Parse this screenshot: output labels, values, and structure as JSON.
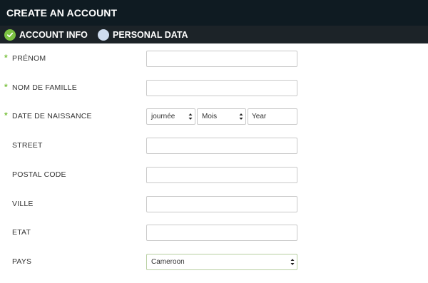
{
  "header": {
    "title": "CREATE AN ACCOUNT"
  },
  "steps": [
    {
      "label": "ACCOUNT INFO",
      "status": "complete",
      "icon": "check-circle-icon"
    },
    {
      "label": "PERSONAL DATA",
      "status": "pending",
      "icon": "circle-icon"
    }
  ],
  "form": {
    "required_marker": "*",
    "first_name": {
      "label": "PRÉNOM",
      "value": ""
    },
    "last_name": {
      "label": "NOM DE FAMILLE",
      "value": ""
    },
    "birth_date": {
      "label": "DATE DE NAISSANCE",
      "day_selected": "journée",
      "month_selected": "Mois",
      "year_placeholder": "Year"
    },
    "street": {
      "label": "STREET",
      "value": ""
    },
    "postal_code": {
      "label": "POSTAL CODE",
      "value": ""
    },
    "city": {
      "label": "VILLE",
      "value": ""
    },
    "state": {
      "label": "ETAT",
      "value": ""
    },
    "country": {
      "label": "PAYS",
      "selected": "Cameroon"
    }
  },
  "colors": {
    "title_bar": "#0f1b22",
    "steps_bar": "#1c2328",
    "accent_green": "#7cc242",
    "pending_step": "#cfdcef"
  }
}
